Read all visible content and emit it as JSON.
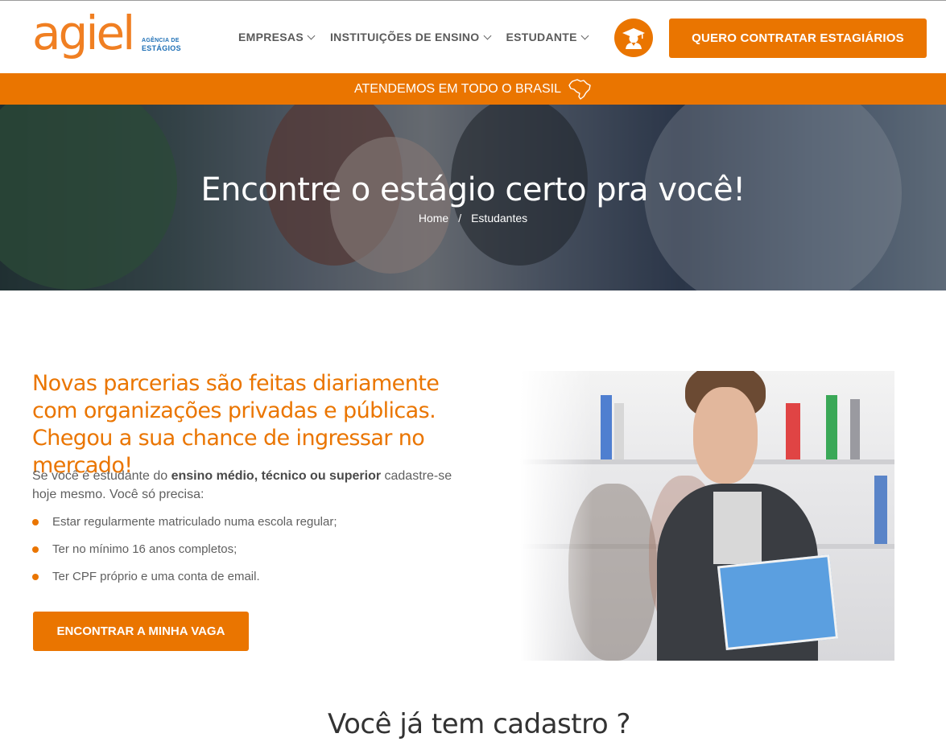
{
  "header": {
    "logo_word": "agiel",
    "logo_sub_1": "AGÊNCIA DE",
    "logo_sub_2": "ESTÁGIOS",
    "nav": [
      {
        "label": "EMPRESAS"
      },
      {
        "label": "INSTITUIÇÕES DE ENSINO"
      },
      {
        "label": "ESTUDANTE"
      }
    ],
    "cta": "QUERO CONTRATAR ESTAGIÁRIOS"
  },
  "band": {
    "text": "ATENDEMOS EM TODO O BRASIL"
  },
  "hero": {
    "title": "Encontre o estágio certo pra você!",
    "breadcrumb": {
      "home": "Home",
      "separator": "/",
      "current": "Estudantes"
    }
  },
  "content": {
    "lead": "Novas parcerias são feitas diariamente com organizações privadas e públicas. Chegou a sua chance de ingressar no mercado!",
    "intro_a": "Se você é estudante do ",
    "intro_bold": "ensino médio, técnico ou superior",
    "intro_b": " cadastre-se hoje mesmo. Você só precisa:",
    "requirements": [
      "Estar regularmente matriculado numa escola regular;",
      "Ter no mínimo 16 anos completos;",
      "Ter CPF próprio e uma conta de email."
    ],
    "button": "ENCONTRAR A MINHA VAGA"
  },
  "section2": {
    "title": "Você já tem cadastro ?"
  },
  "colors": {
    "accent": "#ea7500",
    "logo_orange": "#f07f22",
    "logo_blue": "#1f70b6"
  },
  "icons": {
    "graduate": "graduate-icon",
    "brazil_map": "brazil-map-icon",
    "chevron": "chevron-down-icon"
  }
}
